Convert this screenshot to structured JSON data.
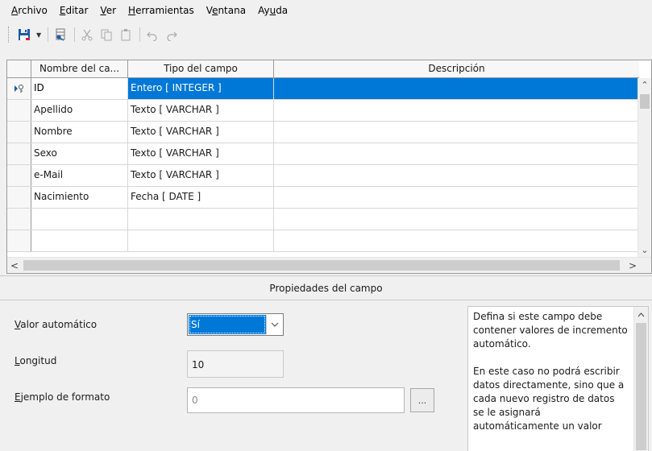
{
  "menu": [
    {
      "pre": "",
      "u": "A",
      "post": "rchivo"
    },
    {
      "pre": "",
      "u": "E",
      "post": "ditar"
    },
    {
      "pre": "",
      "u": "V",
      "post": "er"
    },
    {
      "pre": "",
      "u": "H",
      "post": "erramientas"
    },
    {
      "pre": "V",
      "u": "e",
      "post": "ntana"
    },
    {
      "pre": "Ay",
      "u": "u",
      "post": "da"
    }
  ],
  "toolbar": {
    "icons": [
      "save-icon",
      "dropdown-arrow-icon",
      "primary-key-icon",
      "cut-icon",
      "copy-icon",
      "paste-icon",
      "undo-icon",
      "redo-icon"
    ],
    "accent": "#1e5aa0"
  },
  "table": {
    "headers": [
      "Nombre del ca...",
      "Tipo del campo",
      "Descripción"
    ],
    "rows": [
      {
        "name": "ID",
        "type": "Entero [ INTEGER ]",
        "desc": "",
        "selected": true,
        "key": true
      },
      {
        "name": "Apellido",
        "type": "Texto [ VARCHAR ]",
        "desc": ""
      },
      {
        "name": "Nombre",
        "type": "Texto [ VARCHAR ]",
        "desc": ""
      },
      {
        "name": "Sexo",
        "type": "Texto [ VARCHAR ]",
        "desc": ""
      },
      {
        "name": "e-Mail",
        "type": "Texto [ VARCHAR ]",
        "desc": ""
      },
      {
        "name": "Nacimiento",
        "type": "Fecha [ DATE ]",
        "desc": ""
      },
      {
        "name": "",
        "type": "",
        "desc": ""
      },
      {
        "name": "",
        "type": "",
        "desc": ""
      }
    ],
    "selection_color": "#0078d7"
  },
  "properties": {
    "title": "Propiedades del campo",
    "auto_value": {
      "label_u": "V",
      "label_rest": "alor automático",
      "value": "Sí"
    },
    "length": {
      "label_u": "L",
      "label_rest": "ongitud",
      "value": "10"
    },
    "format": {
      "label_u": "E",
      "label_rest": "jemplo de formato",
      "value": "0",
      "button": "..."
    },
    "help": [
      "Defina si este campo debe contener valores de incremento automático.",
      "En este caso no podrá escribir datos directamente, sino que a cada nuevo registro de datos se le asignará automáticamente un valor"
    ]
  }
}
